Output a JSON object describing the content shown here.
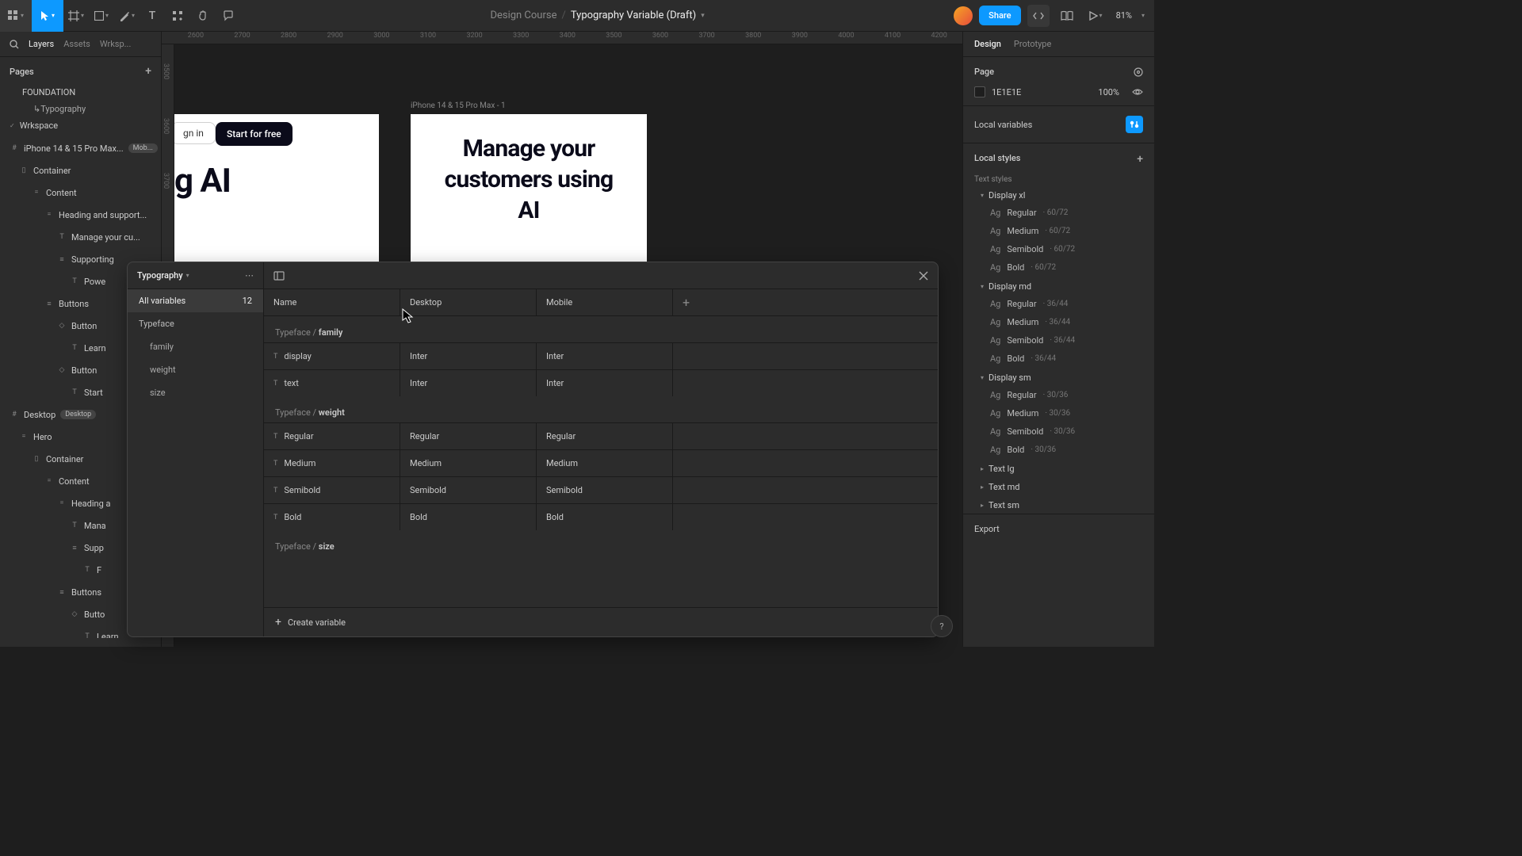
{
  "topbar": {
    "project": "Design Course",
    "file": "Typography Variable (Draft)",
    "share_label": "Share",
    "zoom": "81%"
  },
  "left": {
    "tabs": {
      "layers": "Layers",
      "assets": "Assets",
      "workspace": "Wrksp..."
    },
    "pages_label": "Pages",
    "pages": [
      "FOUNDATION",
      "↳Typography",
      "Wrkspace"
    ],
    "layers": [
      {
        "depth": 0,
        "icon": "#",
        "text": "iPhone 14 & 15 Pro Max...",
        "badge": "Mob..."
      },
      {
        "depth": 1,
        "icon": "▯",
        "text": "Container"
      },
      {
        "depth": 2,
        "icon": "=",
        "text": "Content"
      },
      {
        "depth": 3,
        "icon": "=",
        "text": "Heading and support..."
      },
      {
        "depth": 4,
        "icon": "T",
        "text": "Manage your cu..."
      },
      {
        "depth": 4,
        "icon": "≡",
        "text": "Supporting"
      },
      {
        "depth": 5,
        "icon": "T",
        "text": "Powe"
      },
      {
        "depth": 3,
        "icon": "≡",
        "text": "Buttons"
      },
      {
        "depth": 4,
        "icon": "◇",
        "text": "Button"
      },
      {
        "depth": 5,
        "icon": "T",
        "text": "Learn"
      },
      {
        "depth": 4,
        "icon": "◇",
        "text": "Button"
      },
      {
        "depth": 5,
        "icon": "T",
        "text": "Start "
      },
      {
        "depth": 0,
        "icon": "#",
        "text": "Desktop",
        "badge": "Desktop"
      },
      {
        "depth": 1,
        "icon": "=",
        "text": "Hero"
      },
      {
        "depth": 2,
        "icon": "▯",
        "text": "Container"
      },
      {
        "depth": 3,
        "icon": "=",
        "text": "Content"
      },
      {
        "depth": 4,
        "icon": "=",
        "text": "Heading a"
      },
      {
        "depth": 5,
        "icon": "T",
        "text": "Mana"
      },
      {
        "depth": 5,
        "icon": "≡",
        "text": "Supp"
      },
      {
        "depth": 6,
        "icon": "T",
        "text": "F"
      },
      {
        "depth": 4,
        "icon": "≡",
        "text": "Buttons"
      },
      {
        "depth": 5,
        "icon": "◇",
        "text": "Butto"
      },
      {
        "depth": 6,
        "icon": "T",
        "text": "Learn"
      }
    ]
  },
  "canvas": {
    "ruler_h": [
      "2600",
      "2700",
      "2800",
      "2900",
      "3000",
      "3100",
      "3200",
      "3300",
      "3400",
      "3500",
      "3600",
      "3700",
      "3800",
      "3900",
      "4000",
      "4100",
      "4200"
    ],
    "ruler_v": [
      "3500",
      "3600",
      "3700"
    ],
    "frame1": {
      "signin": "gn in",
      "start": "Start for free",
      "heading": "g AI"
    },
    "frame2": {
      "label": "iPhone 14 & 15 Pro Max - 1",
      "heading": "Manage your customers using AI"
    }
  },
  "vars": {
    "title": "Typography",
    "all_label": "All variables",
    "count": "12",
    "side": [
      "Typeface",
      "family",
      "weight",
      "size"
    ],
    "cols": [
      "Name",
      "Desktop",
      "Mobile"
    ],
    "groups": [
      {
        "path_prefix": "Typeface / ",
        "path_bold": "family",
        "rows": [
          {
            "name": "display",
            "desktop": "Inter",
            "mobile": "Inter"
          },
          {
            "name": "text",
            "desktop": "Inter",
            "mobile": "Inter"
          }
        ]
      },
      {
        "path_prefix": "Typeface / ",
        "path_bold": "weight",
        "rows": [
          {
            "name": "Regular",
            "desktop": "Regular",
            "mobile": "Regular"
          },
          {
            "name": "Medium",
            "desktop": "Medium",
            "mobile": "Medium"
          },
          {
            "name": "Semibold",
            "desktop": "Semibold",
            "mobile": "Semibold"
          },
          {
            "name": "Bold",
            "desktop": "Bold",
            "mobile": "Bold"
          }
        ]
      },
      {
        "path_prefix": "Typeface / ",
        "path_bold": "size",
        "rows": []
      }
    ],
    "create_label": "Create variable"
  },
  "right": {
    "tabs": {
      "design": "Design",
      "prototype": "Prototype"
    },
    "page_label": "Page",
    "page_color": "1E1E1E",
    "opacity": "100%",
    "local_vars": "Local variables",
    "local_styles": "Local styles",
    "text_styles": "Text styles",
    "groups": [
      {
        "name": "Display xl",
        "items": [
          {
            "w": "Regular",
            "s": "60/72"
          },
          {
            "w": "Medium",
            "s": "60/72"
          },
          {
            "w": "Semibold",
            "s": "60/72"
          },
          {
            "w": "Bold",
            "s": "60/72"
          }
        ]
      },
      {
        "name": "Display md",
        "items": [
          {
            "w": "Regular",
            "s": "36/44"
          },
          {
            "w": "Medium",
            "s": "36/44"
          },
          {
            "w": "Semibold",
            "s": "36/44"
          },
          {
            "w": "Bold",
            "s": "36/44"
          }
        ]
      },
      {
        "name": "Display sm",
        "items": [
          {
            "w": "Regular",
            "s": "30/36"
          },
          {
            "w": "Medium",
            "s": "30/36"
          },
          {
            "w": "Semibold",
            "s": "30/36"
          },
          {
            "w": "Bold",
            "s": "30/36"
          }
        ]
      },
      {
        "name": "Text lg",
        "items": []
      },
      {
        "name": "Text md",
        "items": []
      },
      {
        "name": "Text sm",
        "items": []
      }
    ],
    "export": "Export"
  }
}
